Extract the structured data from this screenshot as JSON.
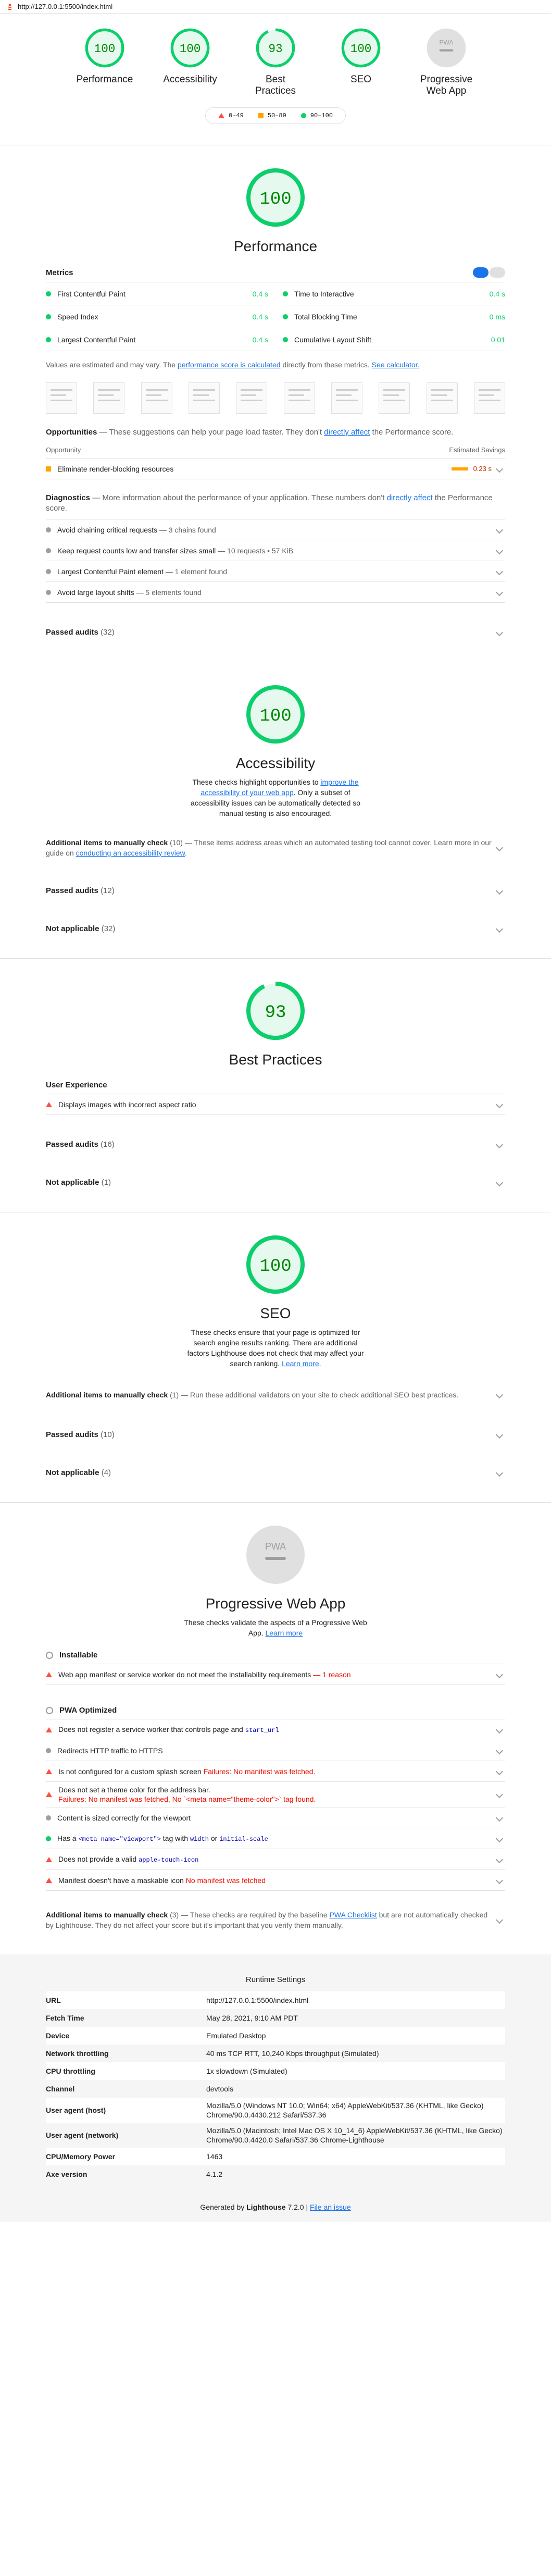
{
  "topbar": {
    "url": "http://127.0.0.1:5500/index.html"
  },
  "summary": [
    {
      "label": "Performance",
      "score": "100",
      "value": 100,
      "color": "#0cce6b"
    },
    {
      "label": "Accessibility",
      "score": "100",
      "value": 100,
      "color": "#0cce6b"
    },
    {
      "label": "Best Practices",
      "score": "93",
      "value": 93,
      "color": "#0cce6b"
    },
    {
      "label": "SEO",
      "score": "100",
      "value": 100,
      "color": "#0cce6b"
    },
    {
      "label": "Progressive Web App",
      "score": "",
      "value": 0,
      "color": "#bdbdbd"
    }
  ],
  "legend": {
    "fail": "0–49",
    "average": "50–89",
    "pass": "90–100"
  },
  "performance": {
    "score": "100",
    "title": "Performance",
    "metrics_title": "Metrics",
    "metrics": [
      {
        "label": "First Contentful Paint",
        "value": "0.4 s"
      },
      {
        "label": "Time to Interactive",
        "value": "0.4 s"
      },
      {
        "label": "Speed Index",
        "value": "0.4 s"
      },
      {
        "label": "Total Blocking Time",
        "value": "0 ms"
      },
      {
        "label": "Largest Contentful Paint",
        "value": "0.4 s"
      },
      {
        "label": "Cumulative Layout Shift",
        "value": "0.01"
      }
    ],
    "note_pre": "Values are estimated and may vary. The ",
    "note_link1": "performance score is calculated",
    "note_mid": " directly from these metrics. ",
    "note_link2": "See calculator.",
    "opp_title": "Opportunities",
    "opp_desc_pre": " — These suggestions can help your page load faster. They don't ",
    "opp_desc_link": "directly affect",
    "opp_desc_post": " the Performance score.",
    "opp_col1": "Opportunity",
    "opp_col2": "Estimated Savings",
    "opportunity": {
      "label": "Eliminate render-blocking resources",
      "savings": "0.23 s"
    },
    "diag_title": "Diagnostics",
    "diag_desc_pre": " — More information about the performance of your application. These numbers don't ",
    "diag_desc_link": "directly affect",
    "diag_desc_post": " the Performance score.",
    "diagnostics": [
      {
        "label": "Avoid chaining critical requests",
        "detail": " — 3 chains found"
      },
      {
        "label": "Keep request counts low and transfer sizes small",
        "detail": " — 10 requests • 57 KiB"
      },
      {
        "label": "Largest Contentful Paint element",
        "detail": " — 1 element found"
      },
      {
        "label": "Avoid large layout shifts",
        "detail": " — 5 elements found"
      }
    ],
    "passed": "Passed audits",
    "passed_count": "(32)"
  },
  "accessibility": {
    "score": "100",
    "title": "Accessibility",
    "desc_pre": "These checks highlight opportunities to ",
    "desc_link": "improve the accessibility of your web app",
    "desc_post": ". Only a subset of accessibility issues can be automatically detected so manual testing is also encouraged.",
    "manual_title": "Additional items to manually check",
    "manual_count": "(10)",
    "manual_desc_pre": " — These items address areas which an automated testing tool cannot cover. Learn more in our guide on ",
    "manual_desc_link": "conducting an accessibility review",
    "manual_desc_post": ".",
    "passed": "Passed audits",
    "passed_count": "(12)",
    "na": "Not applicable",
    "na_count": "(32)"
  },
  "best_practices": {
    "score": "93",
    "title": "Best Practices",
    "group": "User Experience",
    "item": "Displays images with incorrect aspect ratio",
    "passed": "Passed audits",
    "passed_count": "(16)",
    "na": "Not applicable",
    "na_count": "(1)"
  },
  "seo": {
    "score": "100",
    "title": "SEO",
    "desc_pre": "These checks ensure that your page is optimized for search engine results ranking. There are additional factors Lighthouse does not check that may affect your search ranking. ",
    "desc_link": "Learn more",
    "desc_post": ".",
    "manual_title": "Additional items to manually check",
    "manual_count": "(1)",
    "manual_desc": " — Run these additional validators on your site to check additional SEO best practices.",
    "passed": "Passed audits",
    "passed_count": "(10)",
    "na": "Not applicable",
    "na_count": "(4)"
  },
  "pwa": {
    "badge": "PWA",
    "title": "Progressive Web App",
    "desc_pre": "These checks validate the aspects of a Progressive Web App. ",
    "desc_link": "Learn more",
    "installable": "Installable",
    "inst_item": "Web app manifest or service worker do not meet the installability requirements",
    "inst_reason": " — 1 reason",
    "optimized": "PWA Optimized",
    "i1_pre": "Does not register a service worker that controls page and ",
    "i1_code": "start_url",
    "i2": "Redirects HTTP traffic to HTTPS",
    "i3": "Is not configured for a custom splash screen ",
    "i3_fail": "Failures: No manifest was fetched.",
    "i4": "Does not set a theme color for the address bar.",
    "i4_fail": "Failures: No manifest was fetched, No `<meta name=\"theme-color\">` tag found.",
    "i5": "Content is sized correctly for the viewport",
    "i6_a": "Has a ",
    "i6_code1": "<meta name=\"viewport\">",
    "i6_b": " tag with ",
    "i6_code2": "width",
    "i6_c": " or ",
    "i6_code3": "initial-scale",
    "i7_a": "Does not provide a valid ",
    "i7_code": "apple-touch-icon",
    "i8": "Manifest doesn't have a maskable icon ",
    "i8_fail": "No manifest was fetched",
    "manual_title": "Additional items to manually check",
    "manual_count": "(3)",
    "manual_desc_pre": " — These checks are required by the baseline ",
    "manual_desc_link": "PWA Checklist",
    "manual_desc_post": " but are not automatically checked by Lighthouse. They do not affect your score but it's important that you verify them manually."
  },
  "runtime": {
    "title": "Runtime Settings",
    "rows": [
      {
        "k": "URL",
        "v": "http://127.0.0.1:5500/index.html"
      },
      {
        "k": "Fetch Time",
        "v": "May 28, 2021, 9:10 AM PDT"
      },
      {
        "k": "Device",
        "v": "Emulated Desktop"
      },
      {
        "k": "Network throttling",
        "v": "40 ms TCP RTT, 10,240 Kbps throughput (Simulated)"
      },
      {
        "k": "CPU throttling",
        "v": "1x slowdown (Simulated)"
      },
      {
        "k": "Channel",
        "v": "devtools"
      },
      {
        "k": "User agent (host)",
        "v": "Mozilla/5.0 (Windows NT 10.0; Win64; x64) AppleWebKit/537.36 (KHTML, like Gecko) Chrome/90.0.4430.212 Safari/537.36"
      },
      {
        "k": "User agent (network)",
        "v": "Mozilla/5.0 (Macintosh; Intel Mac OS X 10_14_6) AppleWebKit/537.36 (KHTML, like Gecko) Chrome/90.0.4420.0 Safari/537.36 Chrome-Lighthouse"
      },
      {
        "k": "CPU/Memory Power",
        "v": "1463"
      },
      {
        "k": "Axe version",
        "v": "4.1.2"
      }
    ]
  },
  "footer": {
    "pre": "Generated by ",
    "brand": "Lighthouse",
    "ver": " 7.2.0 | ",
    "link": "File an issue"
  }
}
